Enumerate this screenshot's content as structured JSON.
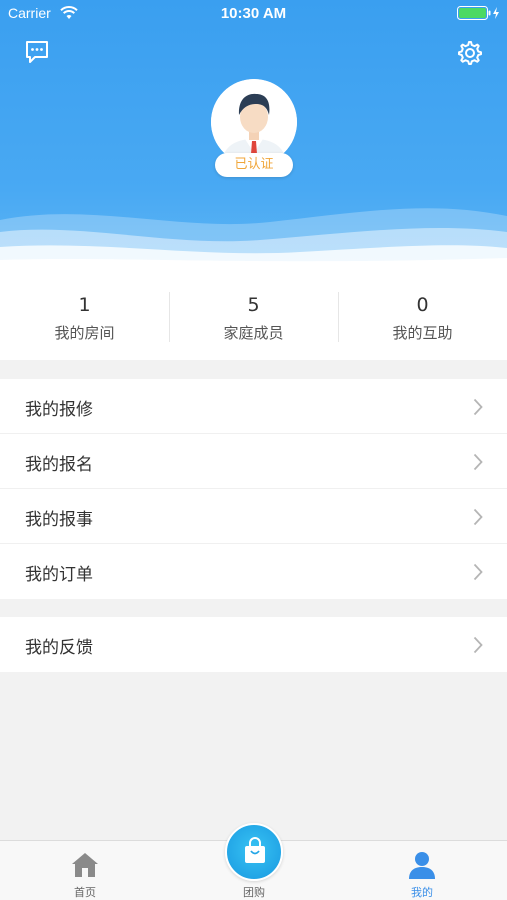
{
  "status_bar": {
    "carrier": "Carrier",
    "time": "10:30 AM"
  },
  "icons": {
    "message": "message-icon",
    "settings": "gear-icon",
    "wifi": "wifi-icon",
    "battery": "battery-icon",
    "chevron": "chevron-right-icon"
  },
  "colors": {
    "primary": "#3a9ff0",
    "badge_text": "#f0a63a",
    "tab_active": "#3a8fe8"
  },
  "profile": {
    "badge": "已认证"
  },
  "stats": [
    {
      "value": "1",
      "label": "我的房间"
    },
    {
      "value": "5",
      "label": "家庭成员"
    },
    {
      "value": "0",
      "label": "我的互助"
    }
  ],
  "menu": {
    "group1": [
      {
        "label": "我的报修"
      },
      {
        "label": "我的报名"
      },
      {
        "label": "我的报事"
      },
      {
        "label": "我的订单"
      }
    ],
    "group2": [
      {
        "label": "我的反馈"
      }
    ]
  },
  "tabbar": {
    "home": "首页",
    "group_buy": "团购",
    "mine": "我的",
    "active": "mine"
  }
}
